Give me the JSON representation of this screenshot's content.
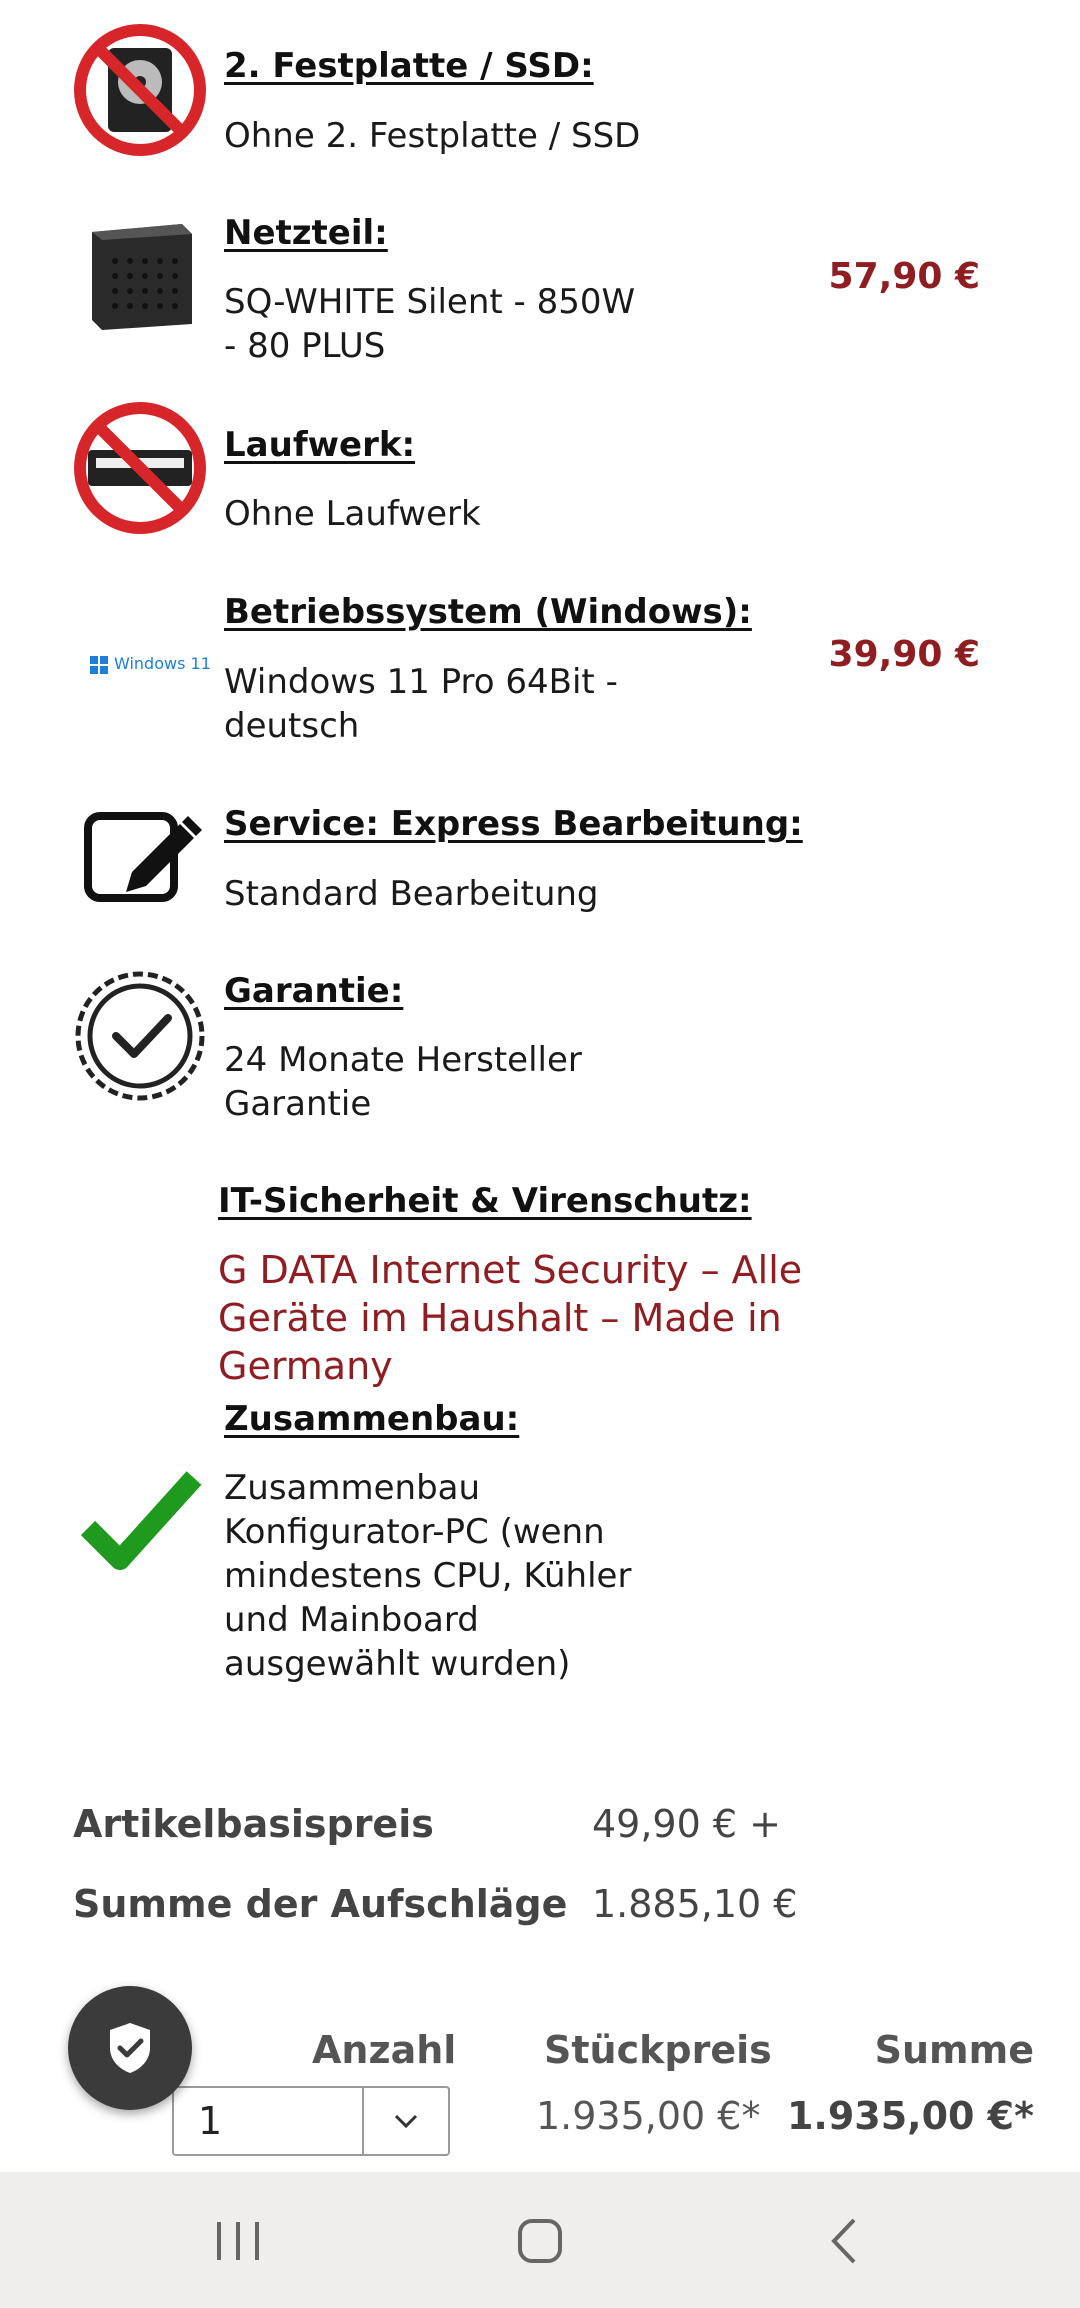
{
  "items": [
    {
      "label": "2. Festplatte / SSD:",
      "value": "Ohne 2. Festplatte / SSD",
      "price": "",
      "icon": "no-hdd-icon"
    },
    {
      "label": "Netzteil:",
      "value": "SQ-WHITE Silent - 850W - 80 PLUS",
      "price": "57,90 €",
      "icon": "power-supply-icon"
    },
    {
      "label": "Laufwerk:",
      "value": "Ohne Laufwerk",
      "price": "",
      "icon": "no-drive-icon"
    },
    {
      "label": "Betriebssystem (Windows):",
      "value": "Windows 11 Pro 64Bit - deutsch",
      "price": "39,90 €",
      "icon": "windows11-logo-icon",
      "logo_text": "Windows 11"
    },
    {
      "label": "Service: Express Bearbeitung:",
      "value": "Standard Bearbeitung",
      "price": "",
      "icon": "edit-icon"
    },
    {
      "label": "Garantie:",
      "value": "24 Monate Hersteller Garantie",
      "price": "",
      "icon": "warranty-seal-icon"
    },
    {
      "label": "IT-Sicherheit & Virenschutz:",
      "value": "G DATA Internet Security – Alle Geräte im Haushalt – Made in Germany",
      "price": ""
    },
    {
      "label": "Zusammenbau:",
      "value": "Zusammenbau Konfigurator-PC (wenn mindestens CPU, Kühler und Mainboard ausgewählt wurden)",
      "price": "",
      "icon": "green-check-icon"
    }
  ],
  "summary": {
    "base_label": "Artikelbasispreis",
    "base_value": "49,90 € +",
    "surcharge_label": "Summe der Aufschläge",
    "surcharge_value": "1.885,10 €"
  },
  "order": {
    "quantity_header": "Anzahl",
    "unit_price_header": "Stückpreis",
    "total_header": "Summe",
    "quantity": "1",
    "unit_price": "1.935,00 €*",
    "total": "1.935,00 €*"
  },
  "colors": {
    "price_red": "#8f1d21",
    "check_green": "#1f9a1f",
    "prohibit_red": "#d7262a"
  }
}
